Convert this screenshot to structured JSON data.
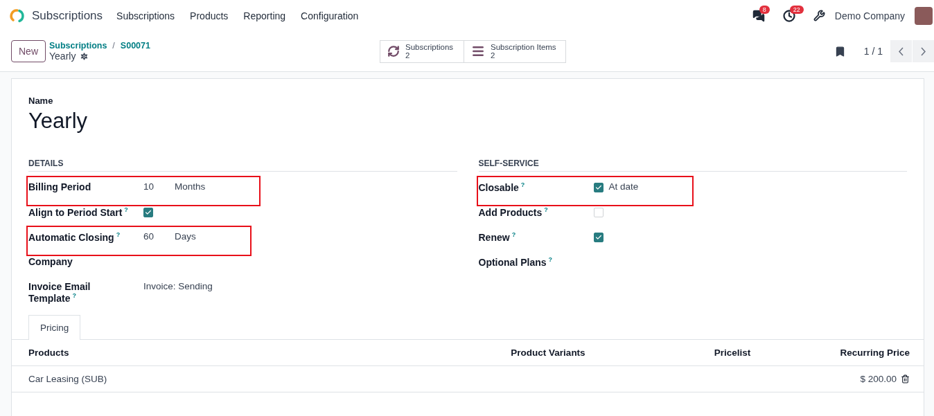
{
  "app_name": "Subscriptions",
  "menu": [
    "Subscriptions",
    "Products",
    "Reporting",
    "Configuration"
  ],
  "systray": {
    "messages_count": "8",
    "activities_count": "22",
    "company": "Demo Company"
  },
  "new_button": "New",
  "breadcrumb": [
    "Subscriptions",
    "S00071"
  ],
  "breadcrumb_separator": "/",
  "record_title": "Yearly",
  "smart_buttons": [
    {
      "kind": "refresh",
      "label": "Subscriptions",
      "count": "2"
    },
    {
      "kind": "list",
      "label": "Subscription Items",
      "count": "2"
    }
  ],
  "pager": "1 / 1",
  "name_label": "Name",
  "name_value": "Yearly",
  "sections": [
    {
      "title": "DETAILS",
      "fields": [
        {
          "label": "Billing Period",
          "kind": "value",
          "values": [
            "10",
            "Months"
          ],
          "highlighted": true
        },
        {
          "label": "Align to Period Start",
          "help": "?",
          "kind": "checkbox",
          "checked": true,
          "highlighted": false
        },
        {
          "label": "Automatic Closing",
          "help": "?",
          "kind": "value",
          "values": [
            "60",
            "Days"
          ],
          "highlighted": true
        },
        {
          "label": "Company",
          "kind": "empty",
          "highlighted": false
        },
        {
          "label": "Invoice Email Template",
          "help": "?",
          "kind": "value",
          "values": [
            "Invoice: Sending"
          ],
          "highlighted": false
        }
      ]
    },
    {
      "title": "SELF-SERVICE",
      "fields": [
        {
          "label": "Closable",
          "help": "?",
          "kind": "checkbox",
          "checked": true,
          "text": "At date",
          "highlighted": true
        },
        {
          "label": "Add Products",
          "help": "?",
          "kind": "checkbox",
          "checked": false,
          "highlighted": false
        },
        {
          "label": "Renew",
          "help": "?",
          "kind": "checkbox",
          "checked": true,
          "highlighted": false
        },
        {
          "label": "Optional Plans",
          "help": "?",
          "kind": "empty",
          "highlighted": false
        }
      ]
    }
  ],
  "tabs": [
    {
      "label": "Pricing",
      "selected": true
    }
  ],
  "table": {
    "columns": [
      "Products",
      "Product Variants",
      "Pricelist",
      "Recurring Price"
    ],
    "rows": [
      {
        "cells": [
          "Car Leasing (SUB)",
          "",
          "",
          "$ 200.00"
        ]
      }
    ]
  }
}
